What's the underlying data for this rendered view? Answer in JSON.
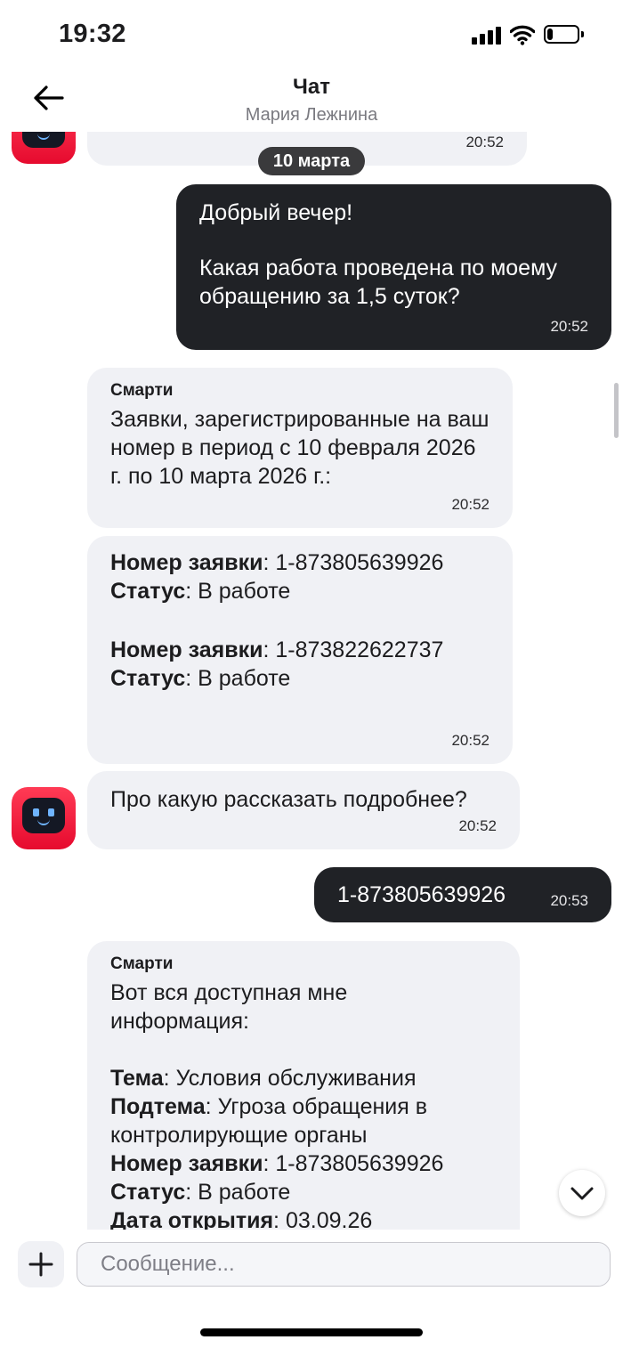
{
  "status_bar": {
    "time": "19:32",
    "battery_level": 0.2
  },
  "header": {
    "title": "Чат",
    "subtitle": "Мария Лежнина"
  },
  "date_separator": "10 марта",
  "messages": {
    "m0": {
      "time": "20:52"
    },
    "m1": {
      "line1": "Добрый вечер!",
      "line2": "Какая работа проведена по моему обращению за 1,5 суток?",
      "time": "20:52"
    },
    "m2": {
      "sender": "Смарти",
      "text": "Заявки, зарегистрированные на ваш номер в период с 10 февраля 2026 г. по 10 марта 2026 г.:",
      "time": "20:52"
    },
    "m3": {
      "req_label": "Номер заявки",
      "req1": ": 1-873805639926",
      "status_label": "Статус",
      "status1": ": В работе",
      "req2": ": 1-873822622737",
      "status2": ": В работе",
      "time": "20:52"
    },
    "m4": {
      "text": "Про какую рассказать подробнее?",
      "time": "20:52"
    },
    "m5": {
      "text": "1-873805639926",
      "time": "20:53"
    },
    "m6": {
      "sender": "Смарти",
      "intro": "Вот вся доступная мне информация:",
      "topic_label": "Тема",
      "topic": ": Условия обслуживания",
      "subtopic_label": "Подтема",
      "subtopic": ": Угроза обращения в контролирующие органы",
      "req_label": "Номер заявки",
      "req": ": 1-873805639926",
      "status_label": "Статус",
      "status": ": В работе",
      "opened_label": "Дата открытия",
      "opened": ": 03.09.26"
    }
  },
  "composer": {
    "placeholder": "Сообщение..."
  },
  "icons": {
    "back": "arrow-left-icon",
    "signal": "cellular-signal-icon",
    "wifi": "wifi-icon",
    "battery": "battery-icon",
    "avatar": "robot-avatar-icon",
    "add": "plus-icon",
    "scroll_down": "chevron-down-icon"
  },
  "colors": {
    "outgoing_bubble": "#202226",
    "incoming_bubble": "#f0f1f5",
    "avatar_red": "#ff3b55",
    "date_badge": "#3a3a3c"
  }
}
